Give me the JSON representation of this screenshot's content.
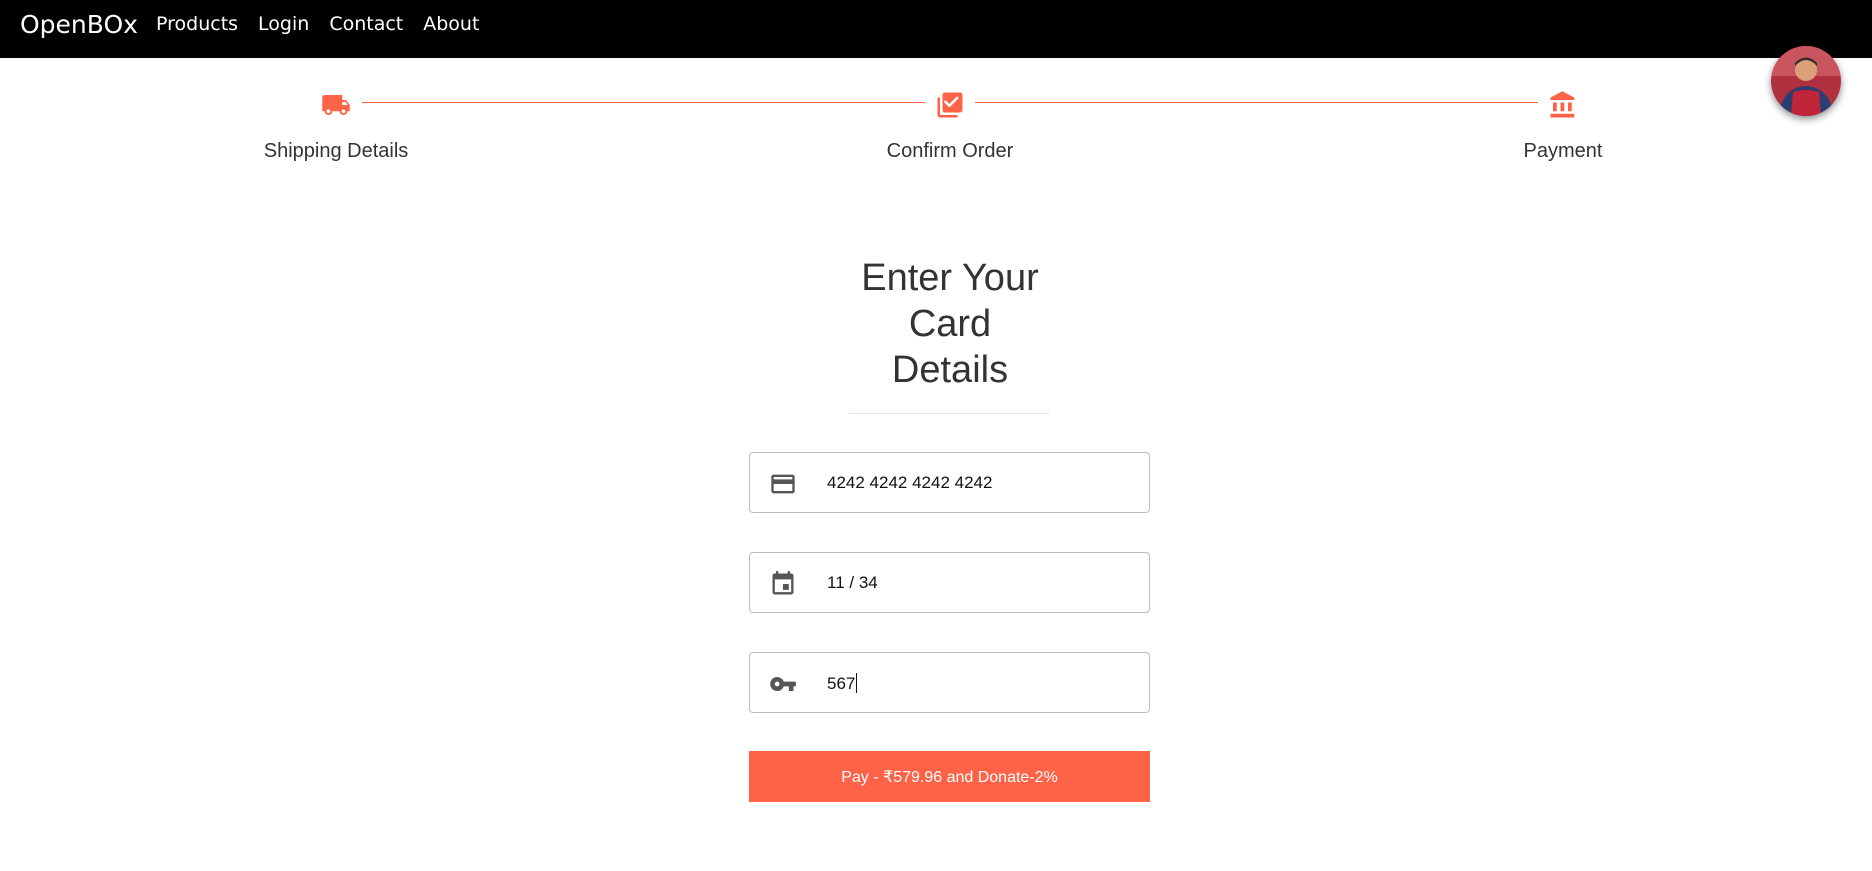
{
  "navbar": {
    "brand": "OpenBOx",
    "links": [
      "Products",
      "Login",
      "Contact",
      "About"
    ]
  },
  "stepper": {
    "steps": [
      {
        "label": "Shipping Details",
        "icon": "truck-icon"
      },
      {
        "label": "Confirm Order",
        "icon": "checklist-icon"
      },
      {
        "label": "Payment",
        "icon": "bank-icon"
      }
    ],
    "accent_color": "#ff6347"
  },
  "payment": {
    "title_lines": [
      "Enter Your",
      "Card",
      "Details"
    ],
    "card_number": "4242 4242 4242 4242",
    "expiry": "11 / 34",
    "cvc": "567",
    "pay_label": "Pay - ₹579.96 and Donate-2%"
  },
  "colors": {
    "navbar_bg": "#000000",
    "accent": "#ff6347",
    "text": "#333333"
  }
}
